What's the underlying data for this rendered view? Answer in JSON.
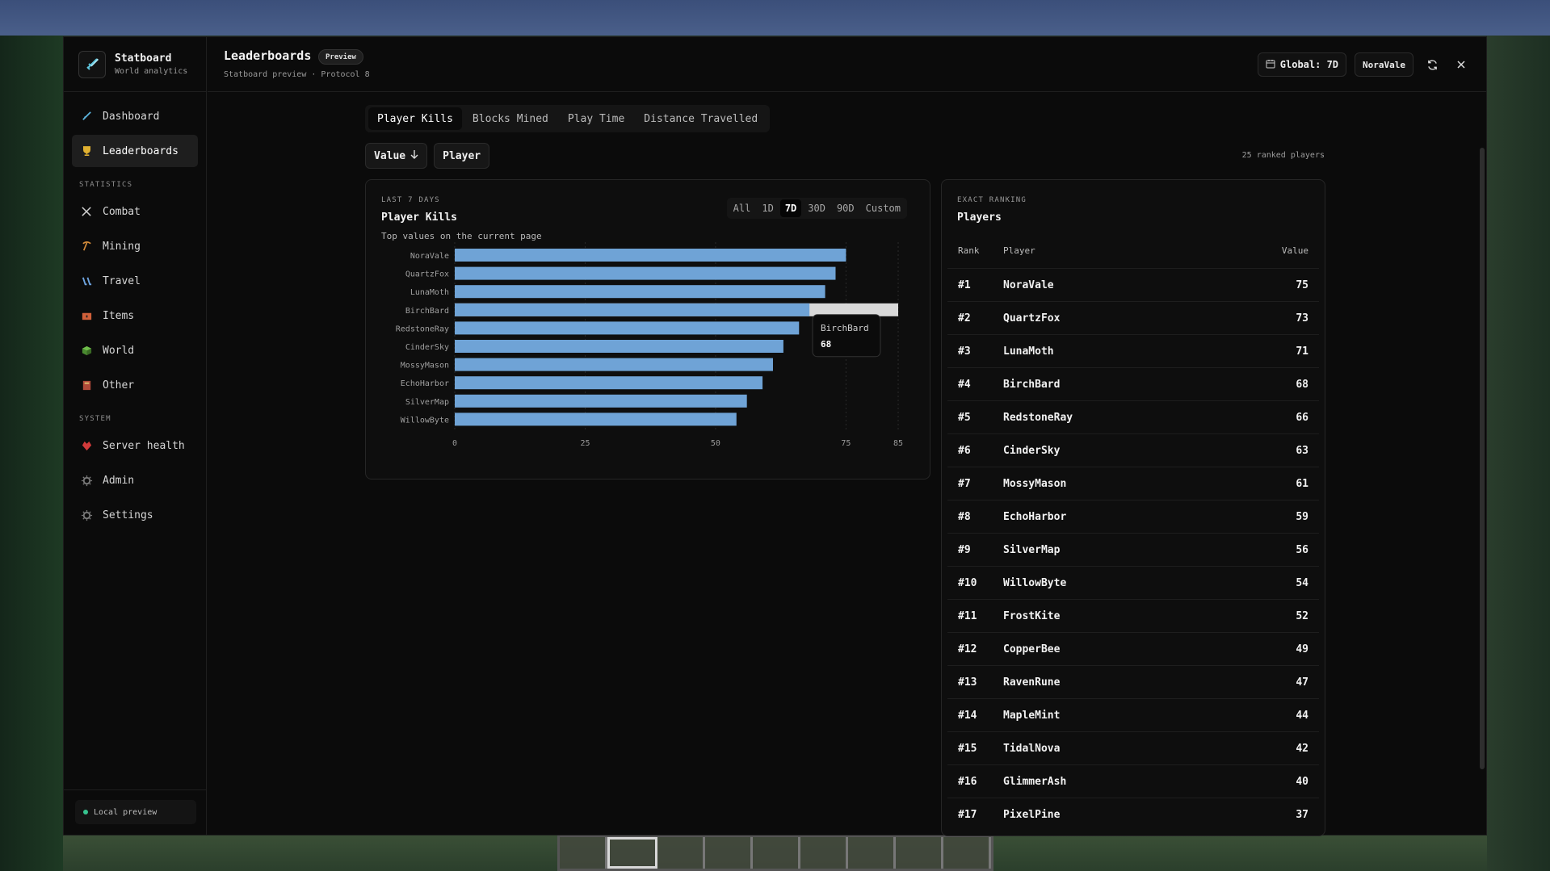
{
  "app": {
    "name": "Statboard",
    "subtitle": "World analytics"
  },
  "header": {
    "title": "Leaderboards",
    "badge": "Preview",
    "subtitle": "Statboard preview · Protocol 8",
    "global_label": "Global: 7D",
    "user": "NoraVale"
  },
  "sidebar": {
    "items": [
      {
        "label": "Dashboard",
        "icon": "sword-icon",
        "color": "#5ab0d8"
      },
      {
        "label": "Leaderboards",
        "icon": "trophy-icon",
        "color": "#e0b030"
      }
    ],
    "stats_heading": "STATISTICS",
    "stats": [
      {
        "label": "Combat",
        "icon": "crossed-swords-icon",
        "color": "#cfcfcf"
      },
      {
        "label": "Mining",
        "icon": "pickaxe-icon",
        "color": "#d28a3a"
      },
      {
        "label": "Travel",
        "icon": "boots-icon",
        "color": "#6ea4e0"
      },
      {
        "label": "Items",
        "icon": "chest-icon",
        "color": "#d0603a"
      },
      {
        "label": "World",
        "icon": "grass-block-icon",
        "color": "#5fae4a"
      },
      {
        "label": "Other",
        "icon": "book-icon",
        "color": "#b04a3a"
      }
    ],
    "system_heading": "SYSTEM",
    "system": [
      {
        "label": "Server health",
        "icon": "heart-icon",
        "color": "#d03a3a"
      },
      {
        "label": "Admin",
        "icon": "gear-icon",
        "color": "#7a7a7a"
      },
      {
        "label": "Settings",
        "icon": "gear-icon",
        "color": "#7a7a7a"
      }
    ],
    "status": "Local preview"
  },
  "tabs": [
    "Player Kills",
    "Blocks Mined",
    "Play Time",
    "Distance Travelled"
  ],
  "sort": {
    "value_label": "Value",
    "player_label": "Player"
  },
  "ranked_count": "25 ranked players",
  "chart_card": {
    "eyebrow": "LAST 7 DAYS",
    "title": "Player Kills",
    "subtitle": "Top values on the current page",
    "ranges": [
      "All",
      "1D",
      "7D",
      "30D",
      "90D",
      "Custom"
    ],
    "active_range": "7D",
    "tooltip": {
      "name": "BirchBard",
      "value": "68"
    }
  },
  "chart_data": {
    "type": "bar",
    "orientation": "horizontal",
    "categories": [
      "NoraVale",
      "QuartzFox",
      "LunaMoth",
      "BirchBard",
      "RedstoneRay",
      "CinderSky",
      "MossyMason",
      "EchoHarbor",
      "SilverMap",
      "WillowByte"
    ],
    "values": [
      75,
      73,
      71,
      68,
      66,
      63,
      61,
      59,
      56,
      54
    ],
    "xlim": [
      0,
      85
    ],
    "xticks": [
      "0",
      "25",
      "50",
      "75",
      "85"
    ],
    "bar_color": "#6fa3d6",
    "highlight": "BirchBard",
    "grid": true
  },
  "table": {
    "eyebrow": "EXACT RANKING",
    "title": "Players",
    "columns": [
      "Rank",
      "Player",
      "Value"
    ],
    "rows": [
      [
        "#1",
        "NoraVale",
        "75"
      ],
      [
        "#2",
        "QuartzFox",
        "73"
      ],
      [
        "#3",
        "LunaMoth",
        "71"
      ],
      [
        "#4",
        "BirchBard",
        "68"
      ],
      [
        "#5",
        "RedstoneRay",
        "66"
      ],
      [
        "#6",
        "CinderSky",
        "63"
      ],
      [
        "#7",
        "MossyMason",
        "61"
      ],
      [
        "#8",
        "EchoHarbor",
        "59"
      ],
      [
        "#9",
        "SilverMap",
        "56"
      ],
      [
        "#10",
        "WillowByte",
        "54"
      ],
      [
        "#11",
        "FrostKite",
        "52"
      ],
      [
        "#12",
        "CopperBee",
        "49"
      ],
      [
        "#13",
        "RavenRune",
        "47"
      ],
      [
        "#14",
        "MapleMint",
        "44"
      ],
      [
        "#15",
        "TidalNova",
        "42"
      ],
      [
        "#16",
        "GlimmerAsh",
        "40"
      ],
      [
        "#17",
        "PixelPine",
        "37"
      ]
    ]
  }
}
